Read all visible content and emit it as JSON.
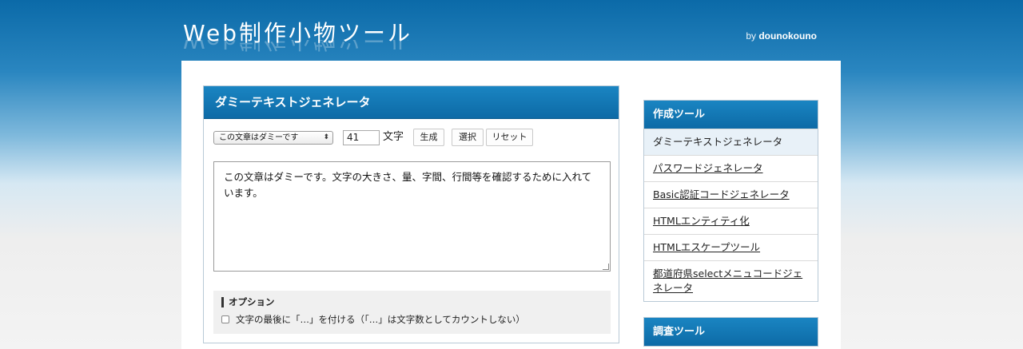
{
  "header": {
    "logo": "Web制作小物ツール",
    "byline_prefix": "by",
    "byline_name": "dounokouno"
  },
  "panel": {
    "title": "ダミーテキストジェネレータ",
    "select_value": "この文章はダミーです",
    "count_value": "41",
    "count_unit": "文字",
    "generate_label": "生成",
    "select_label": "選択",
    "reset_label": "リセット",
    "output_text": "この文章はダミーです。文字の大きさ、量、字間、行間等を確認するために入れています。",
    "options_title": "オプション",
    "option_label": "文字の最後に「…」を付ける（「…」は文字数としてカウントしない）"
  },
  "sidebar": {
    "section1_title": "作成ツール",
    "items": [
      {
        "label": "ダミーテキストジェネレータ"
      },
      {
        "label": "パスワードジェネレータ"
      },
      {
        "label": "Basic認証コードジェネレータ"
      },
      {
        "label": "HTMLエンティティ化"
      },
      {
        "label": "HTMLエスケープツール"
      },
      {
        "label": "都道府県selectメニュコードジェネレータ"
      }
    ],
    "section2_title": "調査ツール"
  },
  "colors": {
    "accent": "#0d6aa6",
    "active_bg": "#e8f1f8"
  }
}
